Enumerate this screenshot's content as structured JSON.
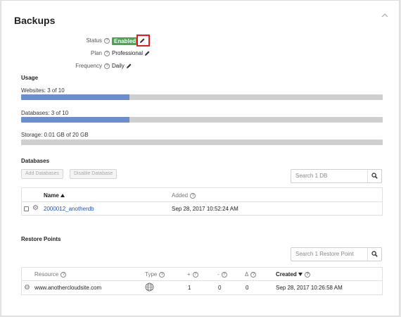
{
  "page": {
    "title": "Backups"
  },
  "properties": {
    "status_label": "Status",
    "status_value": "Enabled",
    "plan_label": "Plan",
    "plan_value": "Professional",
    "frequency_label": "Frequency",
    "frequency_value": "Daily",
    "help_glyph": "?"
  },
  "usage": {
    "heading": "Usage",
    "items": [
      {
        "label": "Websites: 3 of 10",
        "fraction": 0.3
      },
      {
        "label": "Databases: 3 of 10",
        "fraction": 0.3
      },
      {
        "label": "Storage: 0.01 GB of 20 GB",
        "fraction": 0.0005
      }
    ]
  },
  "databases": {
    "heading": "Databases",
    "add_button": "Add Databases",
    "disable_button": "Disable Database",
    "search_placeholder": "Search 1 DB",
    "columns": {
      "name": "Name",
      "added": "Added"
    },
    "rows": [
      {
        "name": "2000012_anotherdb",
        "added": "Sep 28, 2017 10:52:24 AM"
      }
    ]
  },
  "restore_points": {
    "heading": "Restore Points",
    "search_placeholder": "Search 1 Restore Point",
    "columns": {
      "resource": "Resource",
      "type": "Type",
      "plus": "+",
      "minus": "-",
      "delta": "Δ",
      "created": "Created"
    },
    "rows": [
      {
        "resource": "www.anothercloudsite.com",
        "plus": "1",
        "minus": "0",
        "delta": "0",
        "created": "Sep 28, 2017 10:26:58 AM"
      }
    ]
  },
  "icons": {
    "edit": "pencil-icon",
    "search": "search-icon",
    "settings": "gear-icon",
    "collapse": "chevron-up-icon",
    "type_web": "globe-icon",
    "sort_asc": "caret-up-icon",
    "sort_desc": "caret-down-icon"
  },
  "colors": {
    "enabled_badge": "#4ba651",
    "progress_fill": "#6c8ecf",
    "progress_track": "#cfcfcf",
    "highlight_border": "#e02020",
    "link": "#2255aa"
  }
}
